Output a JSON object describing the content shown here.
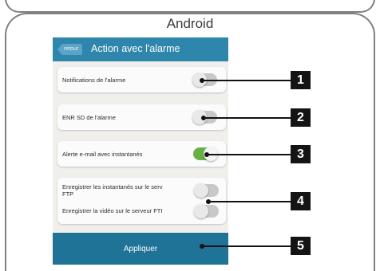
{
  "os_label": "Android",
  "header": {
    "back_label": "retour",
    "title": "Action avec l'alarme"
  },
  "settings": [
    {
      "label": "Notifications de l'alarme",
      "enabled": false
    },
    {
      "label": "ENR SD de l'alarme",
      "enabled": false
    },
    {
      "label": "Alerte e-mail avec instantanés",
      "enabled": true
    },
    {
      "label": "Enregistrer les instantanés sur le serveur FTP",
      "enabled": false
    },
    {
      "label": "Enregistrer la vidéo sur le serveur FTP",
      "enabled": false
    }
  ],
  "setting4_lines": [
    "Enregistrer les instantanés sur le serv",
    "FTP"
  ],
  "setting5_visible": "Enregistrer la vidéo sur le serveur FTI",
  "apply_label": "Appliquer",
  "callouts": [
    "1",
    "2",
    "3",
    "4",
    "5"
  ],
  "colors": {
    "header": "#2f86ad",
    "apply_bar": "#1f7397",
    "toggle_on": "#68b043",
    "toggle_off": "#c8c8c8",
    "callout_box": "#141414"
  }
}
